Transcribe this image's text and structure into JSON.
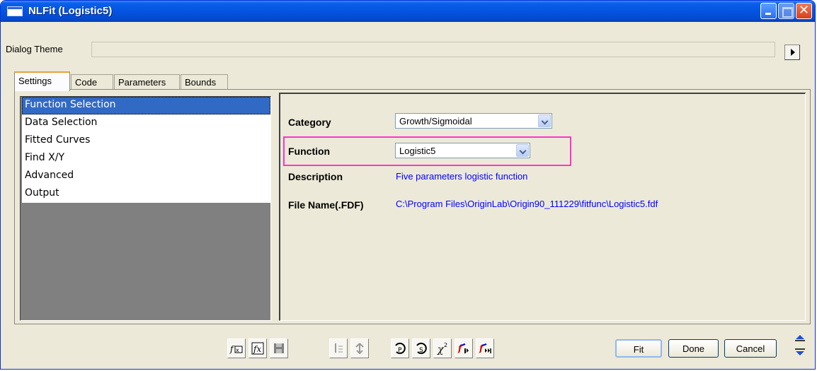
{
  "window": {
    "title": "NLFit (Logistic5)"
  },
  "theme": {
    "label": "Dialog Theme",
    "value": ""
  },
  "tabs": [
    {
      "label": "Settings"
    },
    {
      "label": "Code"
    },
    {
      "label": "Parameters"
    },
    {
      "label": "Bounds"
    }
  ],
  "left_list": [
    {
      "label": "Function Selection",
      "selected": true
    },
    {
      "label": "Data Selection"
    },
    {
      "label": "Fitted Curves"
    },
    {
      "label": "Find X/Y"
    },
    {
      "label": "Advanced"
    },
    {
      "label": "Output"
    }
  ],
  "settings": {
    "category_label": "Category",
    "category_value": "Growth/Sigmoidal",
    "function_label": "Function",
    "function_value": "Logistic5",
    "description_label": "Description",
    "description_value": "Five parameters logistic function",
    "filename_label": "File Name(.FDF)",
    "filename_value": "C:\\Program Files\\OriginLab\\Origin90_111229\\fitfunc\\Logistic5.fdf"
  },
  "toolbar_icons": [
    "edit-function-icon",
    "function-formula-icon",
    "save-icon",
    "sort-down-icon",
    "sort-tree-icon",
    "iterate-p-icon",
    "iterate-s-icon",
    "chi-square-icon",
    "fit-until-converge-icon",
    "fit-all-icon"
  ],
  "buttons": {
    "fit": "Fit",
    "done": "Done",
    "cancel": "Cancel"
  },
  "colors": {
    "accent": "#316ac5",
    "highlight_box": "#ff33cc",
    "link_text": "#0000ff",
    "titlebar": "#0454e0"
  }
}
